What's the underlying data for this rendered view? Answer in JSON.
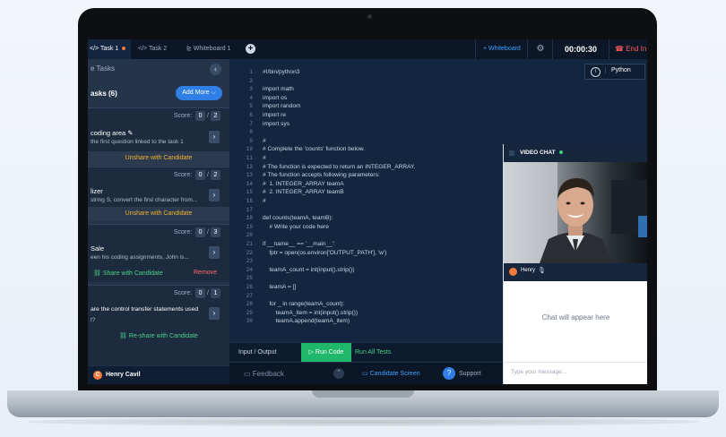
{
  "topbar": {
    "tabs": [
      {
        "label": "</> Task 1",
        "active": true,
        "unsaved": true
      },
      {
        "label": "</> Task 2",
        "active": false
      },
      {
        "label": "⊵ Whiteboard 1",
        "active": false
      }
    ],
    "whiteboard_btn": "+ Whiteboard",
    "timer": "00:00:30",
    "end_label": "End In"
  },
  "left_panel": {
    "header": "e Tasks",
    "task_count": "asks (6)",
    "add_more": "Add More ⌵",
    "cards": [
      {
        "score": "0",
        "max": "2",
        "title": "coding area ✎",
        "desc": "the first question linked to the task 1",
        "action": "Unshare with Candidate"
      },
      {
        "score": "0",
        "max": "2",
        "title": "lizer",
        "desc": "string S, convert the first character from...",
        "action": "Unshare with Candidate"
      },
      {
        "score": "0",
        "max": "3",
        "title": "Sale",
        "desc": "een his coding assignments, John is...",
        "share": "Share with Candidate",
        "remove": "Remove"
      },
      {
        "score": "0",
        "max": "1",
        "title": "are the control transfer statements used",
        "desc": "t?",
        "reshare": "Re-share with Candidate"
      }
    ],
    "score_label": "Score:",
    "user": {
      "initial": "C",
      "name": "Henry Cavil"
    }
  },
  "editor": {
    "language": "Python",
    "lines": [
      "#!/bin/python3",
      "",
      "import math",
      "import os",
      "import random",
      "import re",
      "import sys",
      "",
      "#",
      "# Complete the 'counts' function below.",
      "#",
      "# The function is expected to return an INTEGER_ARRAY.",
      "# The function accepts following parameters:",
      "#  1. INTEGER_ARRAY teamA",
      "#  2. INTEGER_ARRAY teamB",
      "#",
      "",
      "def counts(teamA, teamB):",
      "    # Write your code here",
      "",
      "if __name__ == '__main__':",
      "    fptr = open(os.environ['OUTPUT_PATH'], 'w')",
      "",
      "    teamA_count = int(input().strip())",
      "",
      "    teamA = []",
      "",
      "    for _ in range(teamA_count):",
      "        teamA_item = int(input().strip())",
      "        teamA.append(teamA_item)"
    ],
    "io_label": "Input / Output",
    "run_label": "▷ Run Code",
    "run_all_label": "Run All Tests"
  },
  "footer": {
    "feedback": "Feedback",
    "candidate_screen": "Candidate Screen",
    "support": "Support"
  },
  "video_chat": {
    "title": "VIDEO CHAT",
    "participant": "Henry",
    "chat_placeholder_msg": "Chat will appear here",
    "input_placeholder": "Type your message..."
  }
}
